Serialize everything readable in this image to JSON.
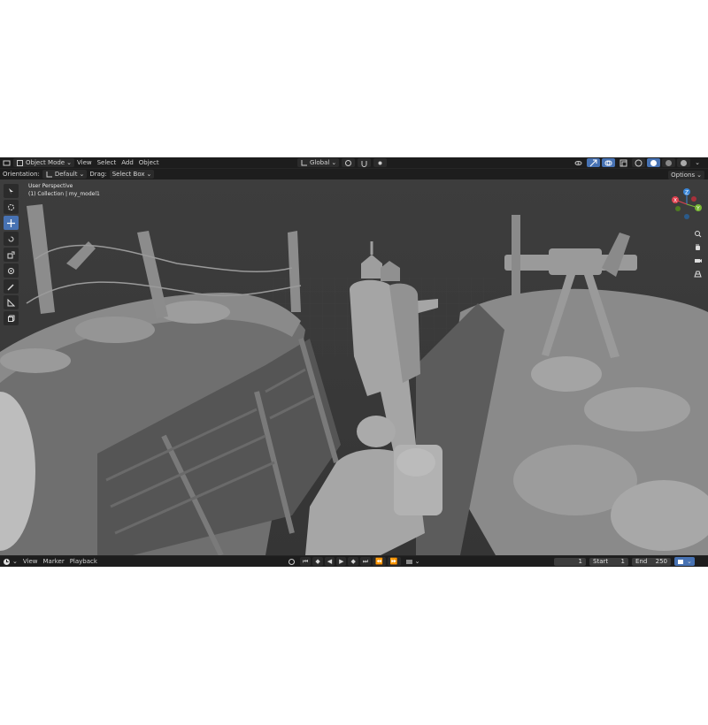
{
  "header": {
    "mode": "Object Mode",
    "menus": [
      "View",
      "Select",
      "Add",
      "Object"
    ],
    "transform_orientation": "Global"
  },
  "toolbar_row": {
    "orientation_label": "Orientation:",
    "orientation_value": "Default",
    "drag_label": "Drag:",
    "drag_value": "Select Box",
    "options": "Options"
  },
  "viewport": {
    "view_name": "User Perspective",
    "collection_info": "(1) Collection | my_model1",
    "gizmo_axes": [
      "X",
      "Y",
      "Z"
    ]
  },
  "tools": [
    "select-box",
    "cursor",
    "move",
    "rotate",
    "scale",
    "transform",
    "annotate",
    "measure",
    "add-cube"
  ],
  "timeline": {
    "menus": [
      "View",
      "Marker",
      "Playback"
    ],
    "current_frame": "1",
    "start_label": "Start",
    "start_value": "1",
    "end_label": "End",
    "end_value": "250"
  },
  "colors": {
    "header_bg": "#1d1d1d",
    "viewport_bg": "#3a3a3a",
    "accent": "#4772b3",
    "axis_x": "#e0414f",
    "axis_y": "#79b833",
    "axis_z": "#3a86d8"
  }
}
